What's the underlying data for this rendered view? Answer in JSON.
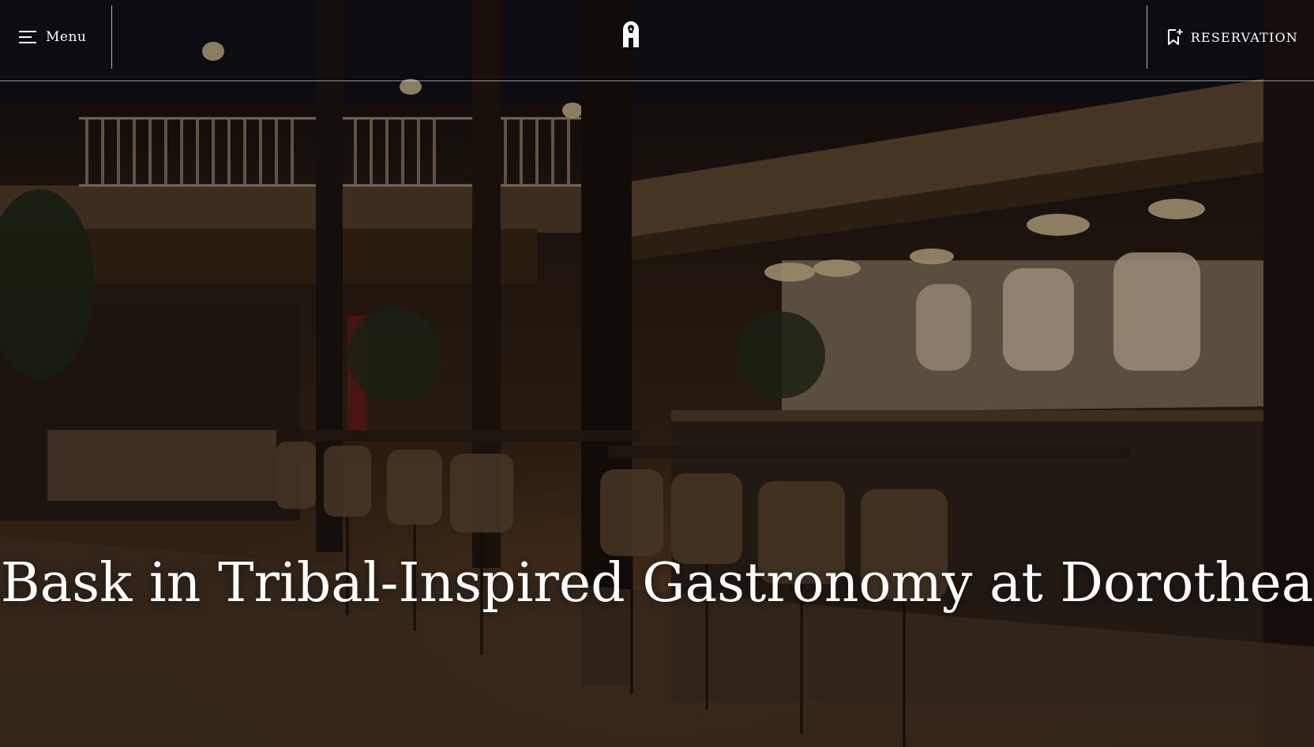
{
  "header": {
    "menu_label": "Menu",
    "reservation_label": "RESERVATION",
    "icons": {
      "menu": "hamburger-icon",
      "logo": "brand-logo",
      "reservation": "bookmark-plus-icon"
    }
  },
  "hero": {
    "headline": "Bask in Tribal-Inspired Gastronomy at Dorothea",
    "background": "restaurant-interior-photo"
  },
  "colors": {
    "text": "#ffffff",
    "overlay": "#1a120b",
    "warm_light": "#c89456"
  }
}
